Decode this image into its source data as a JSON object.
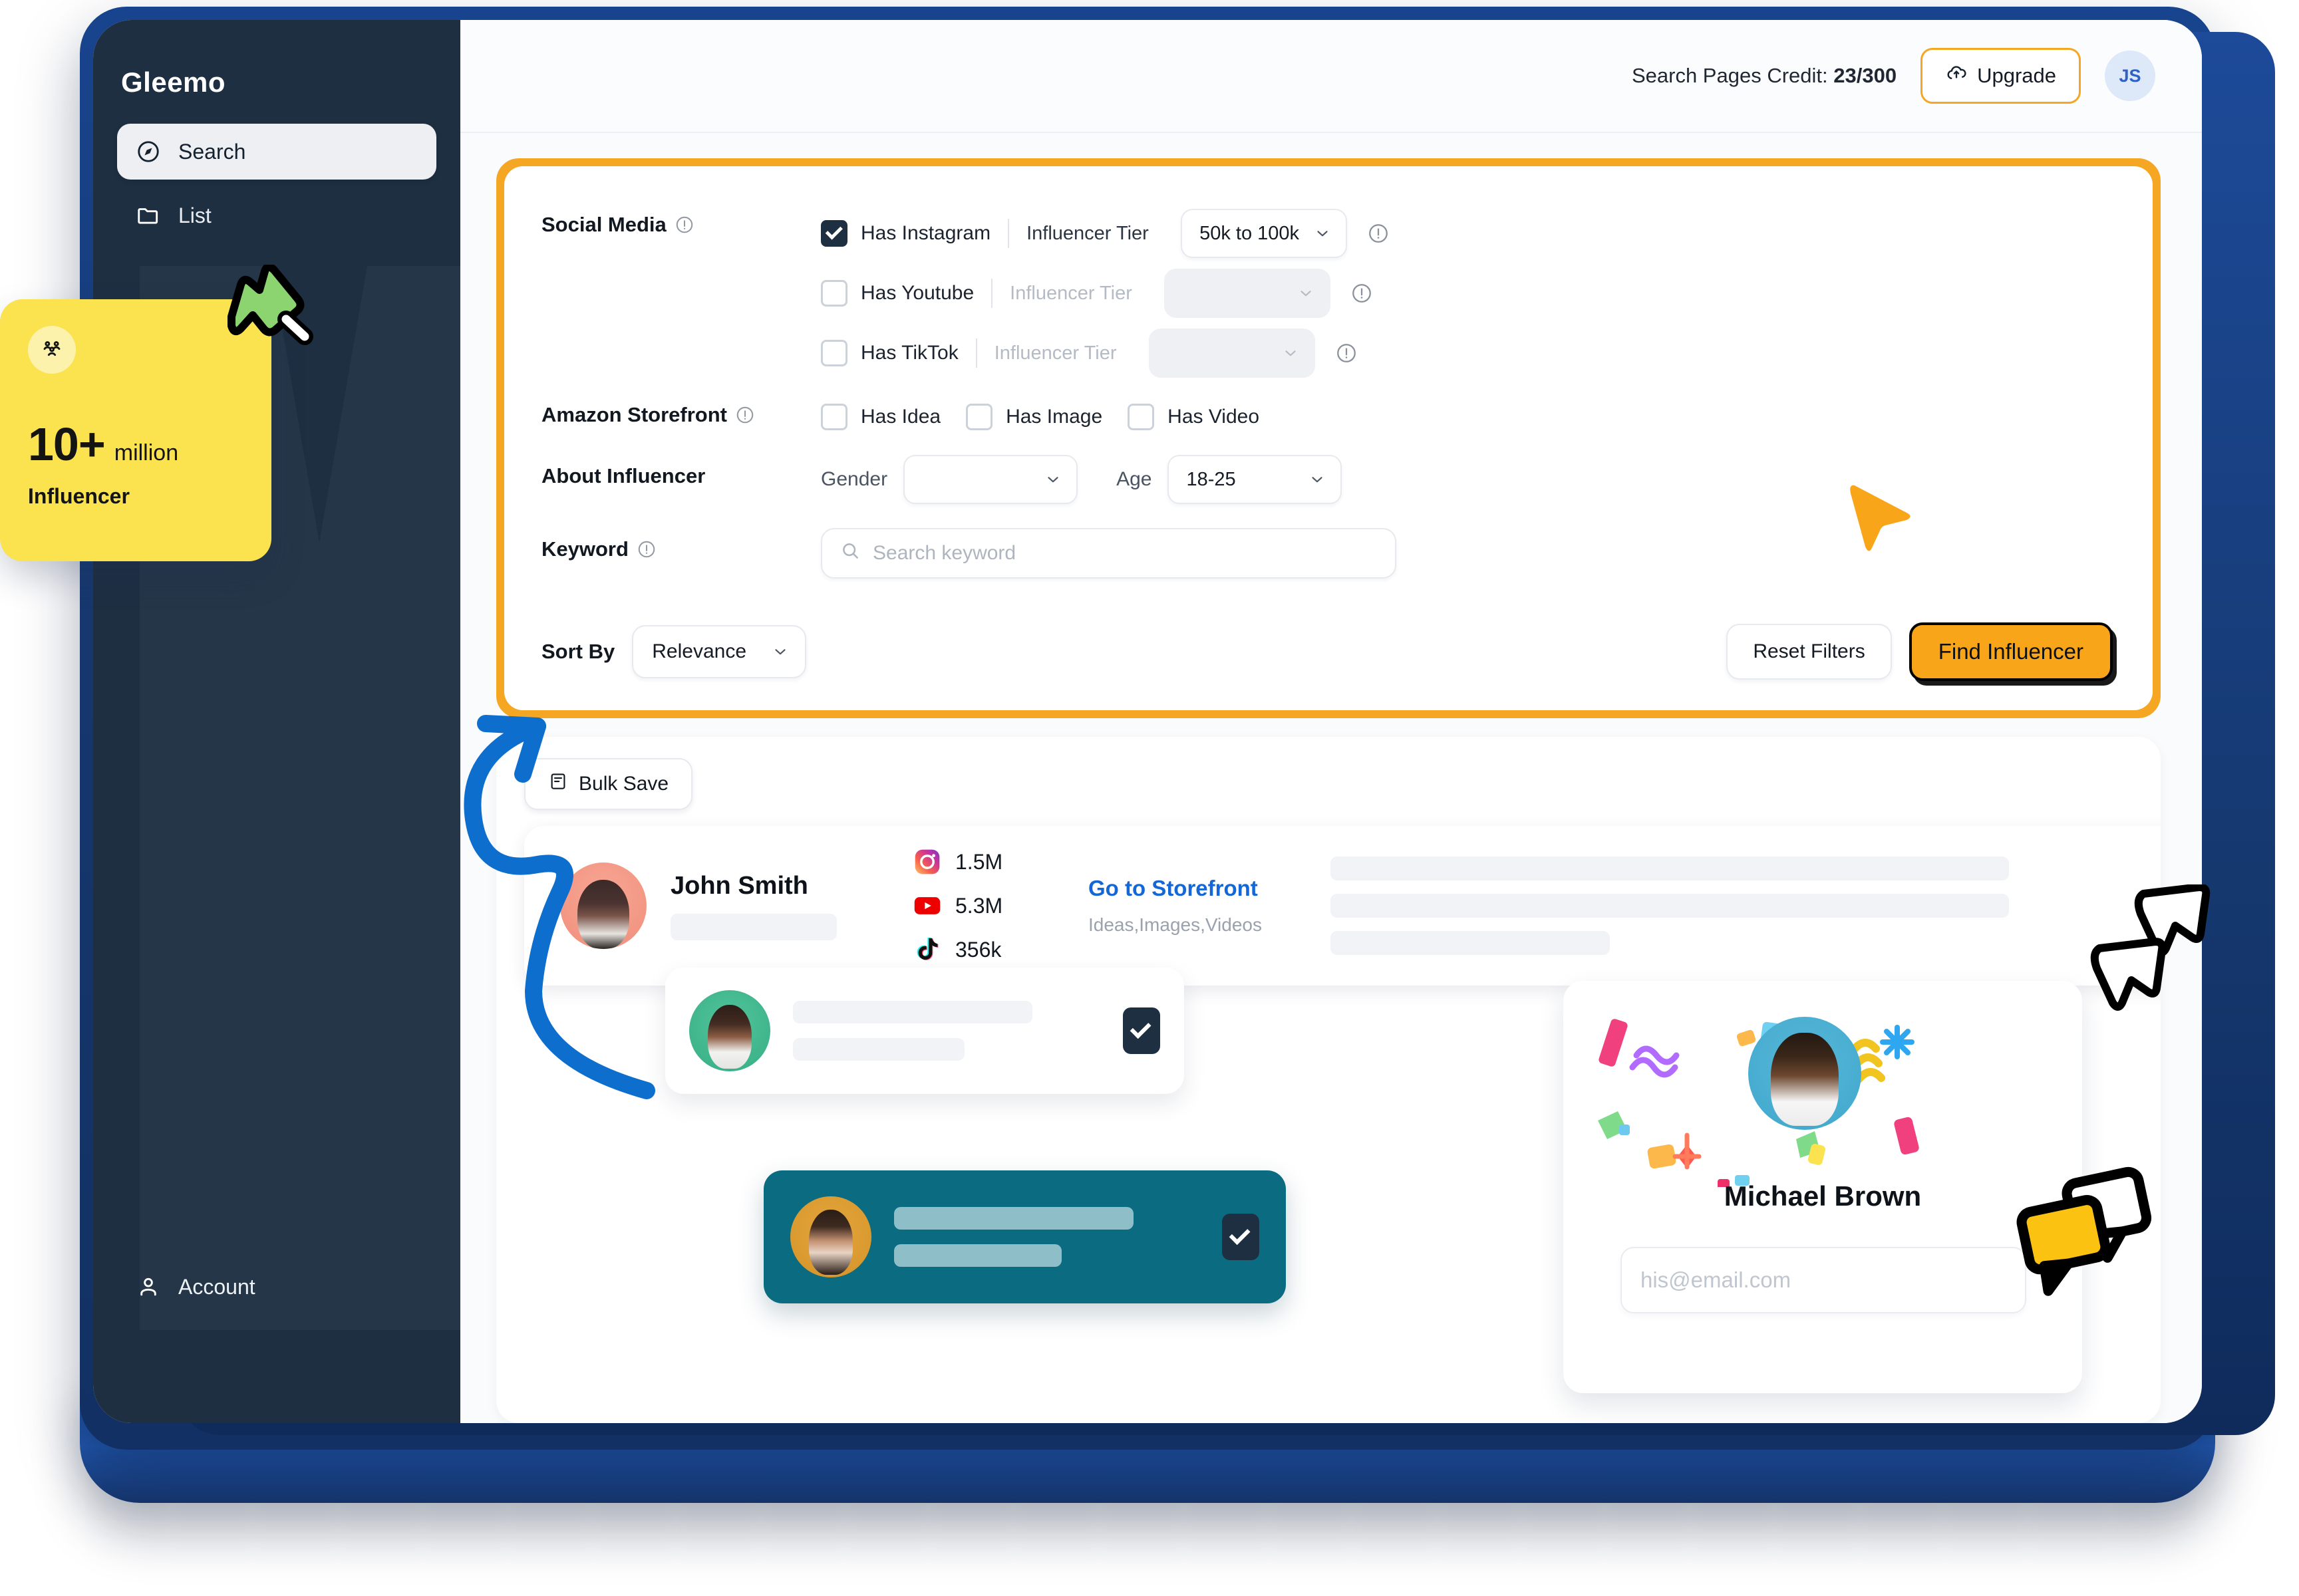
{
  "brand": {
    "name": "Gleemo"
  },
  "sidebar": {
    "items": [
      {
        "label": "Search",
        "icon": "compass-icon",
        "active": true
      },
      {
        "label": "List",
        "icon": "folder-icon",
        "active": false
      }
    ],
    "account": {
      "label": "Account",
      "icon": "user-icon"
    }
  },
  "header": {
    "credit_label": "Search Pages Credit:",
    "credit_value": "23/300",
    "upgrade_label": "Upgrade",
    "upgrade_icon": "upload-cloud-icon",
    "avatar_initials": "JS"
  },
  "filters": {
    "social_media": {
      "label": "Social Media",
      "rows": [
        {
          "checkbox_label": "Has Instagram",
          "checked": true,
          "tier_label": "Influencer Tier",
          "tier_value": "50k to 100k",
          "tier_enabled": true
        },
        {
          "checkbox_label": "Has Youtube",
          "checked": false,
          "tier_label": "Influencer Tier",
          "tier_value": "",
          "tier_enabled": false
        },
        {
          "checkbox_label": "Has TikTok",
          "checked": false,
          "tier_label": "Influencer Tier",
          "tier_value": "",
          "tier_enabled": false
        }
      ]
    },
    "amazon_storefront": {
      "label": "Amazon Storefront",
      "options": [
        {
          "label": "Has Idea",
          "checked": false
        },
        {
          "label": "Has Image",
          "checked": false
        },
        {
          "label": "Has Video",
          "checked": false
        }
      ]
    },
    "about_influencer": {
      "label": "About Influencer",
      "gender_label": "Gender",
      "gender_value": "",
      "age_label": "Age",
      "age_value": "18-25"
    },
    "keyword": {
      "label": "Keyword",
      "placeholder": "Search keyword",
      "value": ""
    },
    "sort": {
      "label": "Sort By",
      "value": "Relevance"
    },
    "reset_label": "Reset Filters",
    "find_label": "Find Influencer"
  },
  "results": {
    "bulk_save_label": "Bulk Save",
    "bulk_save_icon": "save-icon",
    "influencer": {
      "name": "John Smith",
      "socials": [
        {
          "platform": "instagram",
          "value": "1.5M"
        },
        {
          "platform": "youtube",
          "value": "5.3M"
        },
        {
          "platform": "tiktok",
          "value": "356k"
        }
      ],
      "storefront_link": "Go to Storefront",
      "storefront_sub": "Ideas,Images,Videos",
      "star_icon": "star-icon",
      "mail_icon": "mail-icon"
    }
  },
  "floating": {
    "select_card_1": {
      "checked": true
    },
    "select_card_2": {
      "checked": true
    },
    "profile_card": {
      "name": "Michael Brown",
      "email_placeholder": "his@email.com",
      "email_value": ""
    }
  },
  "stat_badge": {
    "number": "10+",
    "unit": "million",
    "caption": "Influencer",
    "icon": "users-icon"
  },
  "colors": {
    "accent_orange": "#f5a623",
    "find_button": "#f9a51a",
    "sidebar": "#1e2f42",
    "laptop_frame": "#1a4590",
    "link_blue": "#1467d6",
    "teal_card": "#0b6b80",
    "badge_yellow": "#fbe24f",
    "arrow_blue": "#0d6ecd"
  }
}
